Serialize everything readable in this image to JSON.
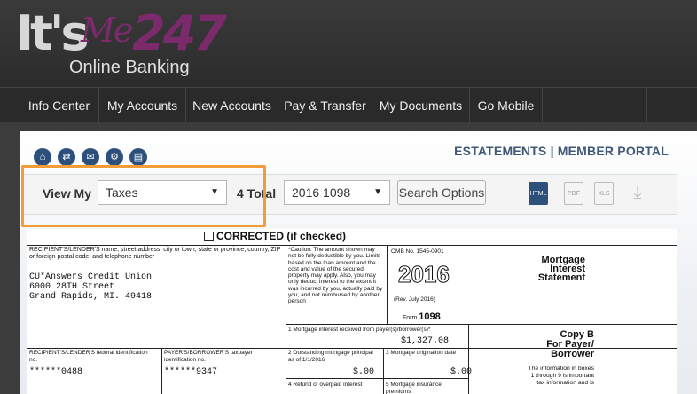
{
  "app": {
    "logo_part1": "It's",
    "logo_part2": "Me",
    "logo_part3": "247",
    "logo_sub": "Online Banking"
  },
  "nav": {
    "items": [
      "Info Center",
      "My Accounts",
      "New Accounts",
      "Pay & Transfer",
      "My Documents",
      "Go Mobile"
    ]
  },
  "portal": {
    "title": "ESTATEMENTS | MEMBER PORTAL",
    "icons": [
      "home-icon",
      "switch-icon",
      "mail-icon",
      "settings-icon",
      "print-icon"
    ]
  },
  "controls": {
    "view_label": "View My",
    "view_value": "Taxes",
    "total_label": "4 Total",
    "doc_value": "2016 1098",
    "search_btn": "Search Options",
    "formats": [
      "HTML",
      "PDF",
      "XLS",
      "download"
    ]
  },
  "form": {
    "corrected": "CORRECTED (if checked)",
    "recipient_hdr": "RECIPIENT'S/LENDER'S name, street address, city or town, state or province, country, ZIP or foreign postal code, and telephone number",
    "recipient_name": "CU*Answers Credit Union",
    "recipient_addr1": "6000 28TH Street",
    "recipient_addr2": "Grand Rapids, MI. 49418",
    "caution": "*Caution: The amount shown may not be fully deductible by you. Limits based on the loan amount and the cost and value of the secured property may apply. Also, you may only deduct interest to the extent it was incurred by you, actually paid by you, and not reimbursed by another person",
    "omb": "OMB No. 1545-0901",
    "year": "2016",
    "rev": "(Rev. July 2016)",
    "form_label": "Form",
    "form_num": "1098",
    "title1": "Mortgage",
    "title2": "Interest",
    "title3": "Statement",
    "box1_label": "1 Mortgage interest received from payer(s)/borrower(s)*",
    "box1_value": "$1,327.08",
    "copyb1": "Copy B",
    "copyb2": "For Payer/",
    "copyb3": "Borrower",
    "recip_id_label": "RECIPIENT'S/LENDER'S federal identification no.",
    "recip_id": "******0488",
    "payer_id_label": "PAYER'S/BORROWER'S taxpayer identification no.",
    "payer_id": "******9347",
    "box2_label": "2 Outstanding mortgage principal as of 1/1/2016",
    "box2_value": "$.00",
    "box3_label": "3 Mortgage origination date",
    "box3_value": "$.00",
    "info_text": "The information in boxes 1 through 9 is important tax information and is",
    "box4_label": "4 Refund of overpaid interest",
    "box5_label": "5 Mortgage insurance premiums"
  }
}
